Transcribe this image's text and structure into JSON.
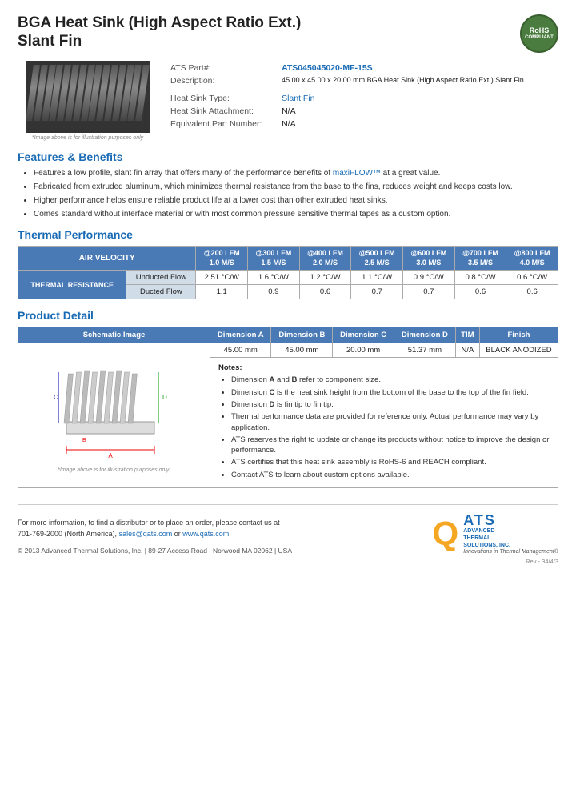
{
  "page": {
    "background": "#f5e6f0"
  },
  "header": {
    "title_line1": "BGA Heat Sink (High Aspect Ratio Ext.)",
    "title_line2": "Slant Fin",
    "rohs": "RoHS\nCOMPLIANT"
  },
  "specs": {
    "part_label": "ATS Part#:",
    "part_value": "ATS045045020-MF-15S",
    "desc_label": "Description:",
    "desc_value": "45.00 x 45.00 x 20.00 mm BGA Heat Sink (High Aspect Ratio Ext.) Slant Fin",
    "type_label": "Heat Sink Type:",
    "type_value": "Slant Fin",
    "attach_label": "Heat Sink Attachment:",
    "attach_value": "N/A",
    "equiv_label": "Equivalent Part Number:",
    "equiv_value": "N/A"
  },
  "image_caption": "*Image above is for illustration purposes only",
  "features": {
    "heading": "Features & Benefits",
    "items": [
      "Features a low profile, slant fin array that offers many of the performance benefits of maxiFLOW™ at a great value.",
      "Fabricated from extruded aluminum, which minimizes thermal resistance from the base to the fins, reduces weight and keeps costs low.",
      "Higher performance helps ensure reliable product life at a lower cost than other extruded heat sinks.",
      "Comes standard without interface material or with most common pressure sensitive thermal tapes as a custom option."
    ],
    "maxiflow_link": "maxiFLOW™"
  },
  "thermal": {
    "heading": "Thermal Performance",
    "col_headers": [
      {
        "lfm": "@200 LFM",
        "ms": "1.0 M/S"
      },
      {
        "lfm": "@300 LFM",
        "ms": "1.5 M/S"
      },
      {
        "lfm": "@400 LFM",
        "ms": "2.0 M/S"
      },
      {
        "lfm": "@500 LFM",
        "ms": "2.5 M/S"
      },
      {
        "lfm": "@600 LFM",
        "ms": "3.0 M/S"
      },
      {
        "lfm": "@700 LFM",
        "ms": "3.5 M/S"
      },
      {
        "lfm": "@800 LFM",
        "ms": "4.0 M/S"
      }
    ],
    "row_label": "THERMAL RESISTANCE",
    "rows": [
      {
        "type": "Unducted Flow",
        "values": [
          "2.51 °C/W",
          "1.6 °C/W",
          "1.2 °C/W",
          "1.1 °C/W",
          "0.9 °C/W",
          "0.8 °C/W",
          "0.6 °C/W"
        ]
      },
      {
        "type": "Ducted Flow",
        "values": [
          "1.1",
          "0.9",
          "0.6",
          "0.7",
          "0.7",
          "0.6",
          "0.6"
        ]
      }
    ]
  },
  "product_detail": {
    "heading": "Product Detail",
    "col_headers": [
      "Schematic Image",
      "Dimension A",
      "Dimension B",
      "Dimension C",
      "Dimension D",
      "TIM",
      "Finish"
    ],
    "schematic_caption": "*Image above is for illustration purposes only.",
    "dim_values": [
      "45.00 mm",
      "45.00 mm",
      "20.00 mm",
      "51.37 mm",
      "N/A",
      "BLACK ANODIZED"
    ],
    "notes_heading": "Notes:",
    "notes": [
      "Dimension A and B refer to component size.",
      "Dimension C is the heat sink height from the bottom of the base to the top of the fin field.",
      "Dimension D is fin tip to fin tip.",
      "Thermal performance data are provided for reference only. Actual performance may vary by application.",
      "ATS reserves the right to update or change its products without notice to improve the design or performance.",
      "ATS certifies that this heat sink assembly is RoHS-6 and REACH compliant.",
      "Contact ATS to learn about custom options available."
    ]
  },
  "footer": {
    "contact_text": "For more information, to find a distributor or to place an order, please contact us at\n701-769-2000 (North America),",
    "email": "sales@qats.com",
    "or_text": "or",
    "website": "www.qats.com",
    "copyright": "© 2013 Advanced Thermal Solutions, Inc.  |  89-27 Access Road  |  Norwood MA  02062  |  USA",
    "ats_q": "Q",
    "ats_name": "ATS",
    "ats_full": "ADVANCED\nTHERMAL\nSOLUTIONS, INC.",
    "ats_tagline": "Innovations in Thermal Management®",
    "rev": "Rev - 34/4/3"
  }
}
